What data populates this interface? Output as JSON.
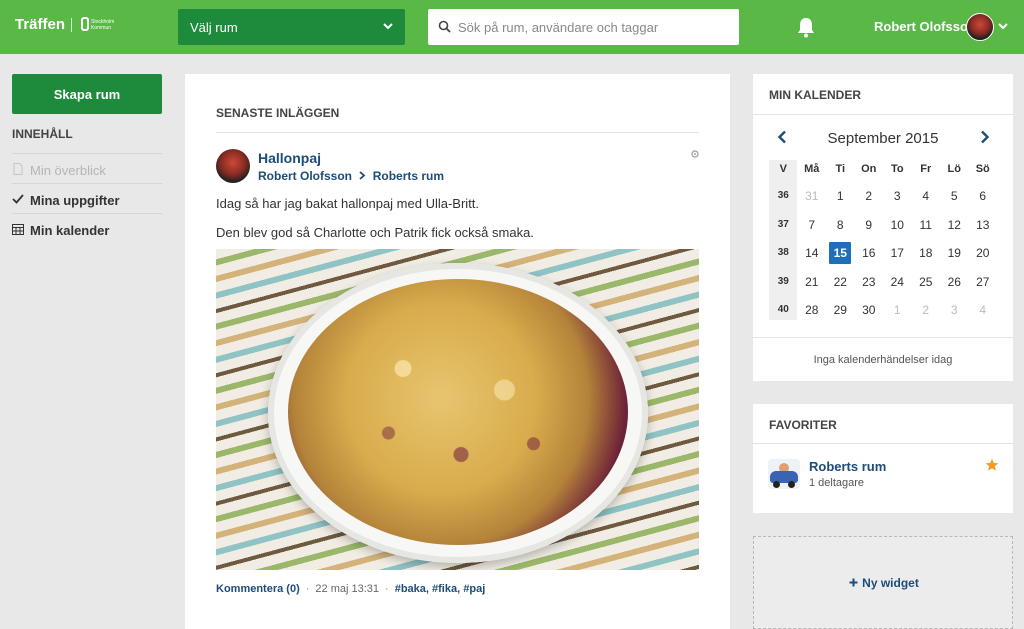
{
  "header": {
    "brand": "Träffen",
    "logo_line1": "Stockholm",
    "logo_line2": "Kommun",
    "room_select_label": "Välj rum",
    "search_placeholder": "Sök på rum, användare och taggar",
    "user_name": "Robert Olofsson",
    "accent_color": "#5ab946"
  },
  "sidebar": {
    "create_button": "Skapa rum",
    "heading": "INNEHÅLL",
    "items": [
      {
        "label": "Min överblick",
        "icon": "document-icon",
        "state": "disabled"
      },
      {
        "label": "Mina uppgifter",
        "icon": "checkmark-icon",
        "state": "active"
      },
      {
        "label": "Min kalender",
        "icon": "calendar-grid-icon",
        "state": "active"
      }
    ]
  },
  "feed": {
    "title": "SENASTE INLÄGGEN",
    "post": {
      "title": "Hallonpaj",
      "author": "Robert Olofsson",
      "room": "Roberts rum",
      "paragraphs": [
        "Idag så har jag bakat hallonpaj med Ulla-Britt.",
        "Den blev god så Charlotte och Patrik fick också smaka."
      ],
      "comment_link": "Kommentera (0)",
      "timestamp": "22 maj 13:31",
      "tags": [
        "#baka",
        "#fika",
        "#paj"
      ]
    }
  },
  "calendar": {
    "heading": "MIN KALENDER",
    "month": "September 2015",
    "week_header": "V",
    "weekdays": [
      "Må",
      "Ti",
      "On",
      "To",
      "Fr",
      "Lö",
      "Sö"
    ],
    "weeks": [
      {
        "week": "36",
        "days": [
          "31",
          "1",
          "2",
          "3",
          "4",
          "5",
          "6"
        ]
      },
      {
        "week": "37",
        "days": [
          "7",
          "8",
          "9",
          "10",
          "11",
          "12",
          "13"
        ]
      },
      {
        "week": "38",
        "days": [
          "14",
          "15",
          "16",
          "17",
          "18",
          "19",
          "20"
        ]
      },
      {
        "week": "39",
        "days": [
          "21",
          "22",
          "23",
          "24",
          "25",
          "26",
          "27"
        ]
      },
      {
        "week": "40",
        "days": [
          "28",
          "29",
          "30",
          "1",
          "2",
          "3",
          "4"
        ]
      }
    ],
    "today": "15",
    "today_color": "#1d6fb8",
    "empty_text": "Inga kalenderhändelser idag"
  },
  "favorites": {
    "heading": "FAVORITER",
    "items": [
      {
        "name": "Roberts rum",
        "members": "1 deltagare",
        "starred": true
      }
    ]
  },
  "new_widget": {
    "label": "Ny widget"
  }
}
